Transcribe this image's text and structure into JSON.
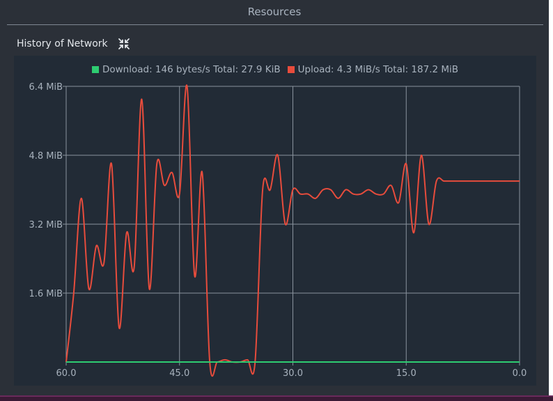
{
  "panel": {
    "title": "Resources"
  },
  "section": {
    "title": "History of Network",
    "collapse_icon": "collapse-arrows-icon"
  },
  "colors": {
    "download": "#2ecc71",
    "upload": "#e74c3c",
    "grid": "#8a939d",
    "background": "#222b36"
  },
  "legend": {
    "download": "Download: 146 bytes/s Total: 27.9 KiB",
    "upload": "Upload: 4.3 MiB/s Total: 187.2 MiB"
  },
  "chart_data": {
    "type": "line",
    "title": "",
    "xlabel": "",
    "ylabel": "",
    "y_unit": "MiB",
    "xlim": [
      60,
      0
    ],
    "ylim": [
      0,
      6.4
    ],
    "x_ticks": [
      60,
      45,
      30,
      15,
      0
    ],
    "x_tick_labels": [
      "60.0",
      "45.0",
      "30.0",
      "15.0",
      "0.0"
    ],
    "y_ticks": [
      1.6,
      3.2,
      4.8,
      6.4
    ],
    "y_tick_labels": [
      "1.6 MiB",
      "3.2 MiB",
      "4.8 MiB",
      "6.4 MiB"
    ],
    "grid": true,
    "legend_position": "top",
    "x": [
      60,
      59,
      58,
      57,
      56,
      55,
      54,
      53,
      52,
      51,
      50,
      49,
      48,
      47,
      46,
      45,
      44,
      43,
      42,
      41,
      40,
      39,
      38,
      37,
      36,
      35,
      34,
      33,
      32,
      31,
      30,
      29,
      28,
      27,
      26,
      25,
      24,
      23,
      22,
      21,
      20,
      19,
      18,
      17,
      16,
      15,
      14,
      13,
      12,
      11,
      10,
      9,
      8,
      7,
      6,
      5,
      4,
      3,
      2,
      1,
      0
    ],
    "series": [
      {
        "name": "Download",
        "values": [
          0,
          0,
          0,
          0,
          0,
          0,
          0,
          0,
          0,
          0,
          0,
          0,
          0,
          0,
          0,
          0,
          0,
          0,
          0,
          0,
          0,
          0,
          0,
          0,
          0,
          0,
          0,
          0,
          0,
          0,
          0,
          0,
          0,
          0,
          0,
          0,
          0,
          0,
          0,
          0,
          0,
          0,
          0,
          0,
          0,
          0,
          0,
          0,
          0,
          0,
          0,
          0,
          0,
          0,
          0,
          0,
          0,
          0,
          0,
          0,
          0
        ]
      },
      {
        "name": "Upload",
        "values": [
          0,
          1.6,
          3.8,
          1.7,
          2.7,
          2.3,
          4.6,
          0.8,
          3.0,
          2.2,
          6.1,
          1.7,
          4.6,
          4.1,
          4.4,
          3.9,
          6.4,
          2.0,
          4.4,
          0,
          0,
          0.05,
          0,
          0,
          0.05,
          0,
          4.0,
          4.0,
          4.8,
          3.2,
          4.0,
          3.9,
          3.9,
          3.8,
          4.0,
          4.0,
          3.8,
          4.0,
          3.9,
          3.9,
          4.0,
          3.9,
          3.9,
          4.1,
          3.7,
          4.6,
          3.0,
          4.8,
          3.2,
          4.2,
          4.2,
          4.2,
          4.2,
          4.2,
          4.2,
          4.2,
          4.2,
          4.2,
          4.2,
          4.2,
          4.2
        ]
      }
    ]
  }
}
